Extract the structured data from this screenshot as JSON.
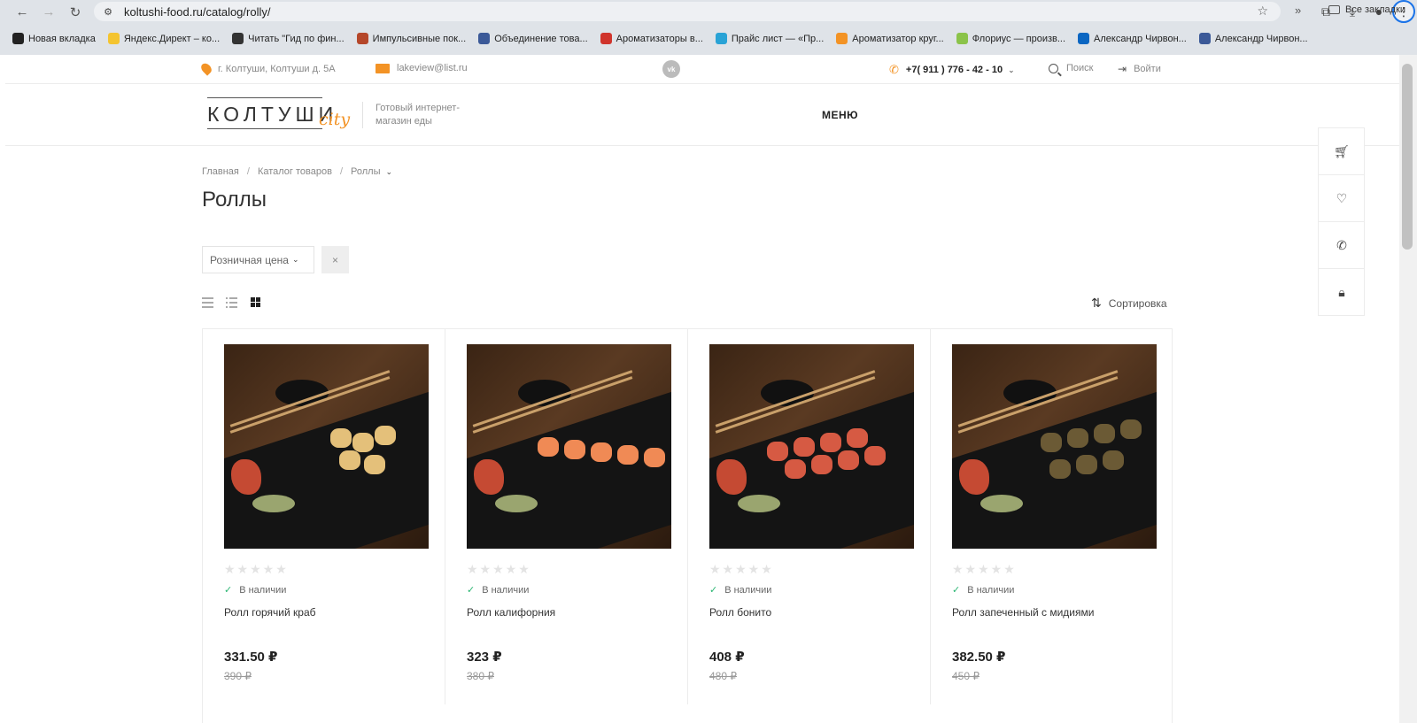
{
  "browser": {
    "url": "koltushi-food.ru/catalog/rolly/",
    "bookmarks": [
      {
        "label": "Новая вкладка",
        "color": "#222222"
      },
      {
        "label": "Яндекс.Директ – ко...",
        "color": "#f4c430"
      },
      {
        "label": "Читать \"Гид по фин...",
        "color": "#333333"
      },
      {
        "label": "Импульсивные пок...",
        "color": "#b5472a"
      },
      {
        "label": "Объединение това...",
        "color": "#3b5998"
      },
      {
        "label": "Ароматизаторы в...",
        "color": "#d0342c"
      },
      {
        "label": "Прайс лист — «Пр...",
        "color": "#29a3d6"
      },
      {
        "label": "Ароматизатор круг...",
        "color": "#f39325"
      },
      {
        "label": "Флориус — произв...",
        "color": "#8bc34a"
      },
      {
        "label": "Александр Чирвон...",
        "color": "#0a66c2"
      },
      {
        "label": "Александр Чирвон...",
        "color": "#3b5998"
      }
    ],
    "more": "»",
    "all_bookmarks": "Все закладки"
  },
  "topbar": {
    "address": "г. Колтуши, Колтуши д. 5А",
    "email": "lakeview@list.ru",
    "vk": "vk",
    "phone": "+7( 911 ) 776 - 42 - 10",
    "search": "Поиск",
    "login": "Войти"
  },
  "header": {
    "logo_main": "КОЛТУШИ",
    "logo_city": "city",
    "tagline": "Готовый интернет-магазин еды",
    "menu": "МЕНЮ"
  },
  "breadcrumbs": [
    "Главная",
    "Каталог товаров",
    "Роллы"
  ],
  "page_title": "Роллы",
  "filter": {
    "label": "Розничная цена",
    "clear": "×"
  },
  "sort_label": "Сортировка",
  "products": [
    {
      "name": "Ролл горячий краб",
      "stock": "В наличии",
      "price": "331.50 ₽",
      "old_price": "390 ₽",
      "roll_color": "#e4c07a"
    },
    {
      "name": "Ролл калифорния",
      "stock": "В наличии",
      "price": "323 ₽",
      "old_price": "380 ₽",
      "roll_color": "#f08a55"
    },
    {
      "name": "Ролл бонито",
      "stock": "В наличии",
      "price": "408 ₽",
      "old_price": "480 ₽",
      "roll_color": "#d65a43"
    },
    {
      "name": "Ролл запеченный с мидиями",
      "stock": "В наличии",
      "price": "382.50 ₽",
      "old_price": "450 ₽",
      "roll_color": "#6b5a35"
    }
  ],
  "colors": {
    "accent": "#f39325",
    "in_stock": "#2bb673"
  }
}
